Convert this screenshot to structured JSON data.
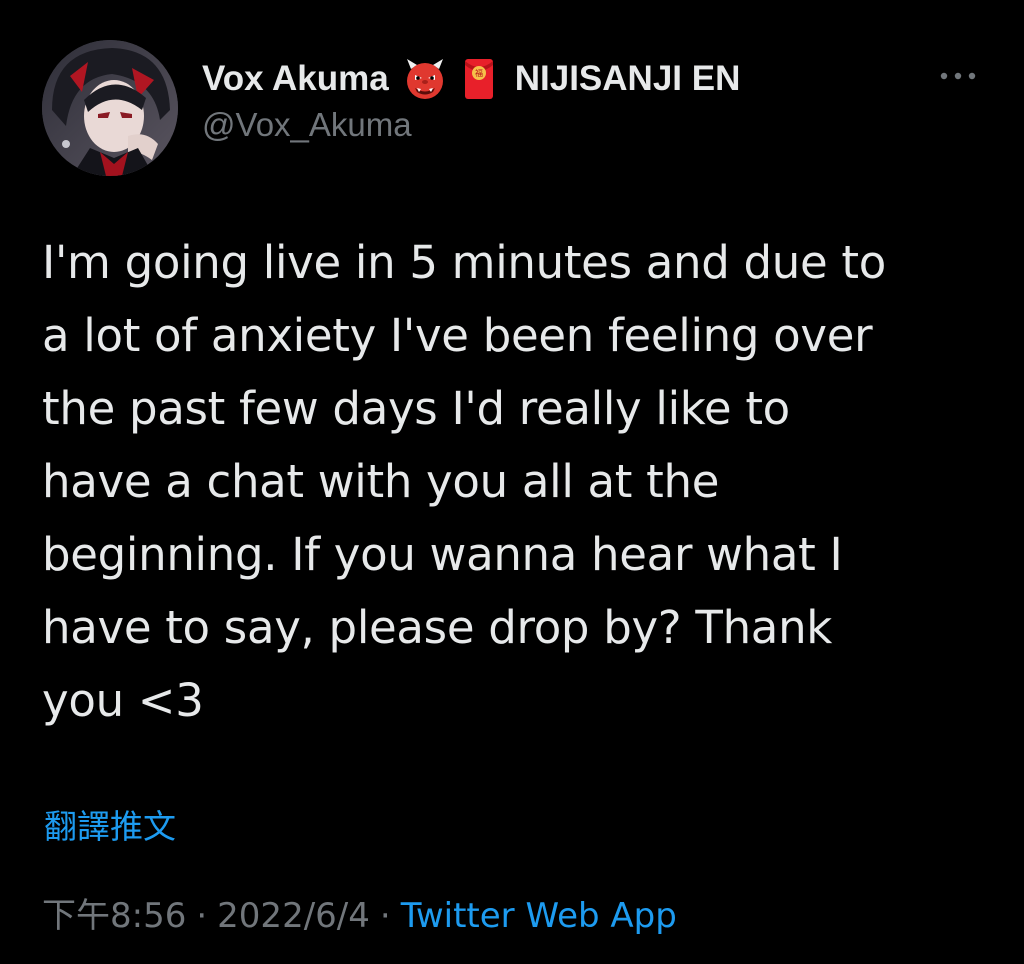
{
  "author": {
    "display_name": "Vox Akuma",
    "org_name": "NIJISANJI EN",
    "handle": "@Vox_Akuma",
    "emojis": [
      "japanese-ogre-emoji",
      "red-envelope-emoji"
    ]
  },
  "tweet": {
    "text": "I'm going live in 5 minutes and due to\na lot of anxiety I've been feeling over\nthe past few days I'd really like to\nhave a chat with you all at the\nbeginning. If you wanna hear what I\nhave to say, please drop by? Thank\nyou <3",
    "translate_label": "翻譯推文",
    "time": "下午8:56",
    "separator": "·",
    "date": "2022/6/4",
    "source": "Twitter Web App"
  },
  "icons": {
    "more": "more-horizontal-icon"
  },
  "colors": {
    "background": "#000000",
    "text": "#e7e9ea",
    "secondary_text": "#71767b",
    "link": "#1d9bf0"
  }
}
